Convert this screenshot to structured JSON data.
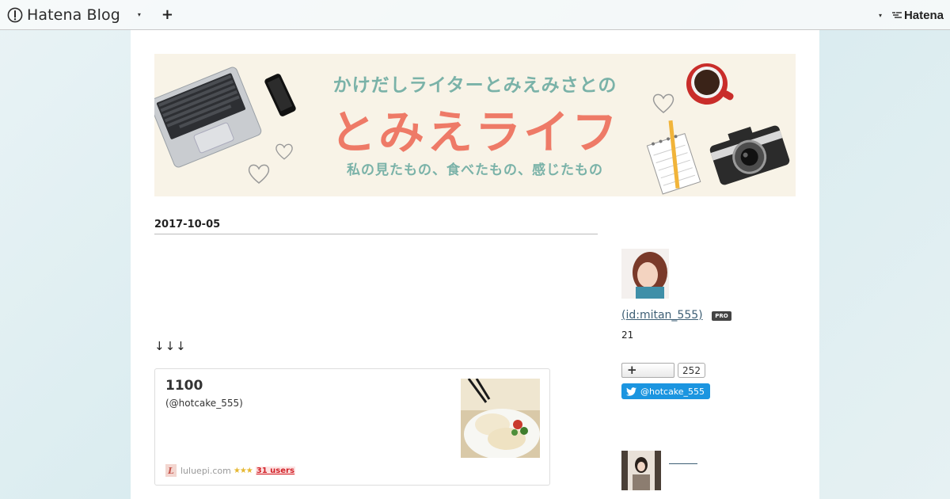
{
  "topbar": {
    "brand": "Hatena Blog",
    "plus": "+",
    "caret": "▾",
    "service": "Hatena"
  },
  "header": {
    "line1": "かけだしライターとみえみさとの",
    "line2": "とみえライフ",
    "line3": "私の見たもの、食べたもの、感じたもの"
  },
  "entry": {
    "date": "2017-10-05",
    "arrows": "↓↓↓",
    "card": {
      "title": "1100",
      "subtitle": "(@hotcake_555)",
      "site_initial": "L",
      "site": "luluepi.com",
      "stars": "★★★",
      "users": "31 users"
    }
  },
  "sidebar": {
    "id_link": " (id:mitan_555)",
    "pro": "PRO",
    "count": "21",
    "follow_plus": "+",
    "follow_count": "252",
    "twitter": "@hotcake_555"
  },
  "icons": [
    "hatena-blog-logo-icon",
    "hatena-mark-icon",
    "twitter-bird-icon",
    "plus-icon",
    "chevron-down-icon"
  ],
  "colors": {
    "header_teal": "#7ab2a8",
    "header_coral": "#ee7a67",
    "twitter_blue": "#1b95e0",
    "users_red": "#d2232a"
  }
}
